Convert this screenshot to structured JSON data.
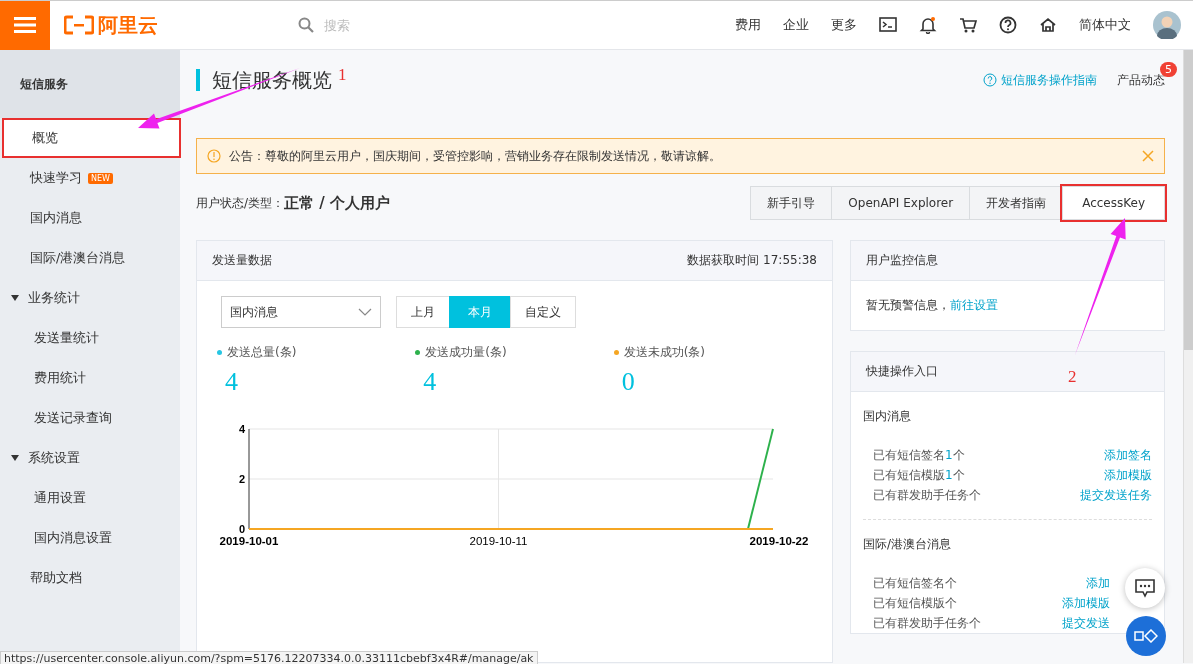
{
  "topbar": {
    "logo": "阿里云",
    "search": {
      "placeholder": "搜索"
    },
    "nav_links": [
      "费用",
      "企业",
      "更多"
    ],
    "language": "简体中文"
  },
  "sidebar": {
    "title": "短信服务",
    "items": [
      {
        "label": "概览",
        "selected": true,
        "highlighted": true
      },
      {
        "label": "快速学习",
        "badge": "NEW",
        "selected": false
      },
      {
        "label": "国内消息",
        "selected": false
      },
      {
        "label": "国际/港澳台消息",
        "selected": false
      },
      {
        "label": "业务统计",
        "expanded": true,
        "children": [
          {
            "label": "发送量统计",
            "selected": false
          },
          {
            "label": "费用统计",
            "selected": false
          },
          {
            "label": "发送记录查询",
            "selected": false
          }
        ]
      },
      {
        "label": "系统设置",
        "expanded": true,
        "children": [
          {
            "label": "通用设置",
            "selected": false
          },
          {
            "label": "国内消息设置",
            "selected": false
          }
        ]
      },
      {
        "label": "帮助文档",
        "selected": false
      }
    ]
  },
  "page": {
    "title": "短信服务概览",
    "guide_link": "短信服务操作指南",
    "product_news": {
      "label": "产品动态",
      "badge": "5"
    }
  },
  "notice": {
    "text": "公告：尊敬的阿里云用户，国庆期间，受管控影响，营销业务存在限制发送情况，敬请谅解。"
  },
  "user_status": {
    "label": "用户状态/类型：",
    "value": "正常 / 个人用户"
  },
  "action_buttons": [
    {
      "label": "新手引导",
      "highlighted": false
    },
    {
      "label": "OpenAPI Explorer",
      "highlighted": false
    },
    {
      "label": "开发者指南",
      "highlighted": false
    },
    {
      "label": "AccessKey",
      "highlighted": true
    }
  ],
  "send_card": {
    "title": "发送量数据",
    "fetch_time": "数据获取时间 17:55:38",
    "dropdown": {
      "value": "国内消息"
    },
    "periods": [
      {
        "label": "上月",
        "selected": false
      },
      {
        "label": "本月",
        "selected": true
      },
      {
        "label": "自定义",
        "selected": false
      }
    ],
    "stats": [
      {
        "label": "发送总量(条)",
        "value": "4",
        "color": "#27c6e3"
      },
      {
        "label": "发送成功量(条)",
        "value": "4",
        "color": "#2db14c"
      },
      {
        "label": "发送未成功(条)",
        "value": "0",
        "color": "#f5a623"
      }
    ],
    "chart_data": {
      "type": "line",
      "categories": [
        "2019-10-01",
        null,
        null,
        null,
        null,
        null,
        null,
        null,
        null,
        null,
        "2019-10-11",
        null,
        null,
        null,
        null,
        null,
        null,
        null,
        null,
        null,
        null,
        "2019-10-22"
      ],
      "series": [
        {
          "color": "#2db14c",
          "values": [
            null,
            null,
            null,
            null,
            null,
            null,
            null,
            null,
            null,
            null,
            null,
            null,
            null,
            null,
            null,
            null,
            null,
            null,
            null,
            null,
            0,
            4
          ]
        },
        {
          "color": "#f5a623",
          "values": [
            0,
            0,
            0,
            0,
            0,
            0,
            0,
            0,
            0,
            0,
            0,
            0,
            0,
            0,
            0,
            0,
            0,
            0,
            0,
            0,
            0,
            0
          ]
        }
      ],
      "ylim": [
        0,
        4
      ],
      "yticks": [
        0,
        2,
        4
      ]
    }
  },
  "monitor_card": {
    "title": "用户监控信息",
    "text": "暂无预警信息，",
    "link": "前往设置"
  },
  "quick_card": {
    "title": "快捷操作入口",
    "groups": [
      {
        "title": "国内消息",
        "rows": [
          {
            "prefix": "已有短信签名",
            "count": "1",
            "suffix": "个",
            "link": "添加签名"
          },
          {
            "prefix": "已有短信模版",
            "count": "1",
            "suffix": "个",
            "link": "添加模版"
          },
          {
            "prefix": "已有群发助手任务个",
            "link": "提交发送任务"
          }
        ]
      },
      {
        "title": "国际/港澳台消息",
        "rows": [
          {
            "prefix": "已有短信签名个",
            "link": "添加"
          },
          {
            "prefix": "已有短信模版个",
            "link": "添加模版"
          },
          {
            "prefix": "已有群发助手任务个",
            "link": "提交发送"
          }
        ]
      }
    ]
  },
  "annotations": [
    {
      "label": "1"
    },
    {
      "label": "2"
    }
  ],
  "status_url": "https://usercenter.console.aliyun.com/?spm=5176.12207334.0.0.33111cbebf3x4R#/manage/ak"
}
